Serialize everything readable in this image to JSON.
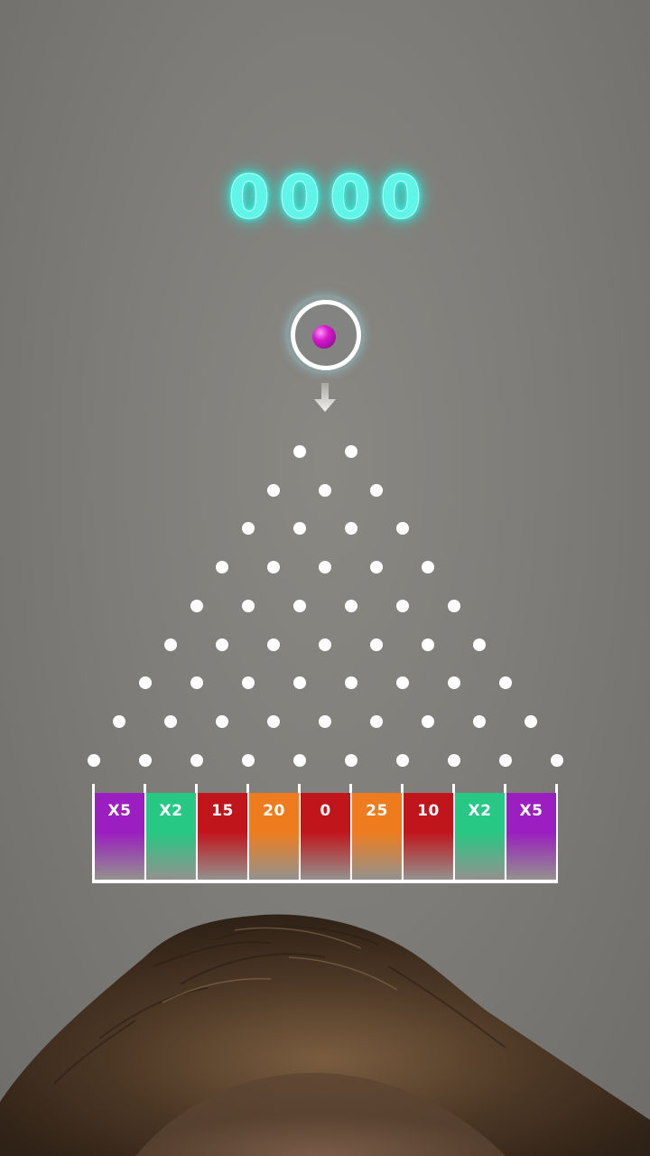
{
  "score": {
    "digits": [
      "0",
      "0",
      "0",
      "0"
    ],
    "color": "#5ff5e8"
  },
  "launcher": {
    "ball_color": "#d81ad0",
    "ring_color": "#ffffff",
    "arrow_icon": "down-arrow-icon"
  },
  "board": {
    "peg_rows": [
      2,
      3,
      4,
      5,
      6,
      7,
      8,
      9,
      10
    ],
    "peg_color": "#ffffff"
  },
  "bins": [
    {
      "label": "X5",
      "color": "#9a1ec0"
    },
    {
      "label": "X2",
      "color": "#27c884"
    },
    {
      "label": "15",
      "color": "#c0151b"
    },
    {
      "label": "20",
      "color": "#ee7c1e"
    },
    {
      "label": "0",
      "color": "#c0151b"
    },
    {
      "label": "25",
      "color": "#ee7c1e"
    },
    {
      "label": "10",
      "color": "#c0151b"
    },
    {
      "label": "X2",
      "color": "#27c884"
    },
    {
      "label": "X5",
      "color": "#9a1ec0"
    }
  ],
  "camera": {
    "subject": "hair-top-of-head"
  }
}
